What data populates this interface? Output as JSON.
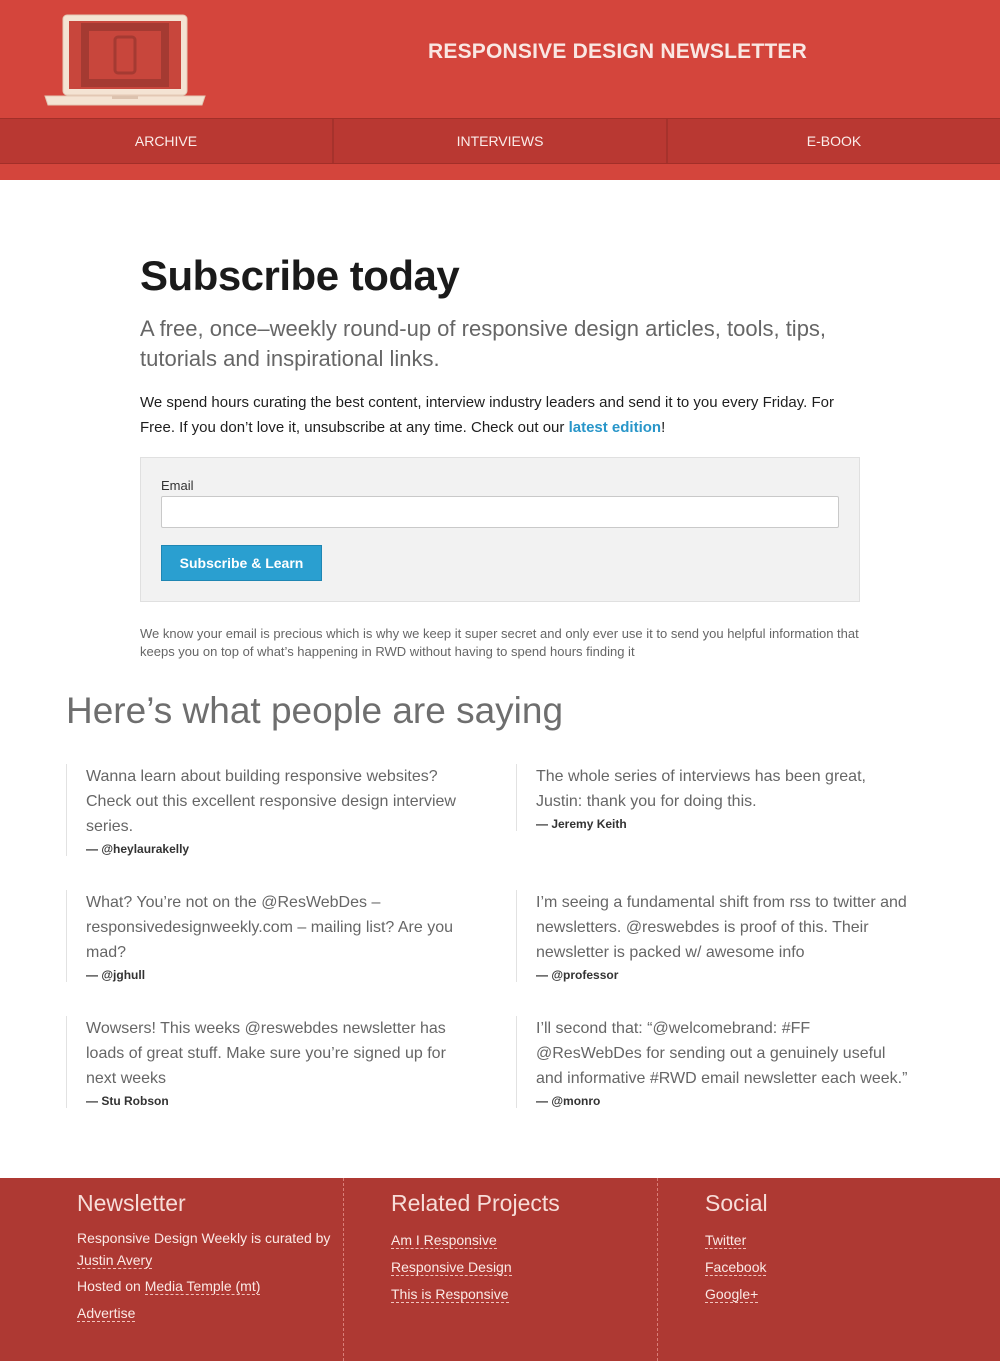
{
  "colors": {
    "header_bg": "#d4453c",
    "nav_bg": "#b93832",
    "footer_bg": "#ae3933",
    "accent_link": "#2996c9",
    "button_bg": "#2a9fd0"
  },
  "header": {
    "logo_icon": "laptop-with-phone-icon",
    "site_title": "RESPONSIVE DESIGN NEWSLETTER",
    "nav": [
      {
        "label": "ARCHIVE"
      },
      {
        "label": "INTERVIEWS"
      },
      {
        "label": "E-BOOK"
      }
    ]
  },
  "subscribe": {
    "title": "Subscribe today",
    "lead": "A free, once–weekly round-up of responsive design articles, tools, tips, tutorials and inspirational links.",
    "intro_before": "We spend hours curating the best content, interview industry leaders and send it to you every Friday. For Free. If you don’t love it, unsubscribe at any time. Check out our ",
    "intro_link": "latest edition",
    "intro_after": "!",
    "form": {
      "email_label": "Email",
      "email_value": "",
      "email_placeholder": "",
      "submit_label": "Subscribe & Learn"
    },
    "privacy": "We know your email is precious which is why we keep it super secret and only ever use it to send you helpful information that keeps you on top of what’s happening in RWD without having to spend hours finding it"
  },
  "testimonials": {
    "heading": "Here’s what people are saying",
    "items": [
      {
        "text": "Wanna learn about building responsive websites? Check out this excellent responsive design interview series.",
        "author": "— @heylaurakelly"
      },
      {
        "text": "The whole series of interviews has been great, Justin: thank you for doing this.",
        "author": "— Jeremy Keith"
      },
      {
        "text": "What? You’re not on the @ResWebDes – responsivedesignweekly.com – mailing list? Are you mad?",
        "author": "— @jghull"
      },
      {
        "text": "I’m seeing a fundamental shift from rss to twitter and newsletters. @reswebdes is proof of this. Their newsletter is packed w/ awesome info",
        "author": "— @professor"
      },
      {
        "text": "Wowsers! This weeks @reswebdes newsletter has loads of great stuff. Make sure you’re signed up for next weeks",
        "author": "— Stu Robson"
      },
      {
        "text": "I’ll second that: “@welcomebrand: #FF @ResWebDes for sending out a genuinely useful and informative #RWD email newsletter each week.”",
        "author": "— @monro"
      }
    ]
  },
  "footer": {
    "newsletter": {
      "heading": "Newsletter",
      "curated_text": "Responsive Design Weekly is curated by ",
      "curator_link": "Justin Avery",
      "hosted_text": "Hosted on ",
      "host_link": "Media Temple (mt)",
      "advertise_link": "Advertise"
    },
    "related": {
      "heading": "Related Projects",
      "links": [
        "Am I Responsive",
        "Responsive Design",
        "This is Responsive"
      ]
    },
    "social": {
      "heading": "Social",
      "links": [
        "Twitter",
        "Facebook",
        "Google+"
      ]
    }
  }
}
